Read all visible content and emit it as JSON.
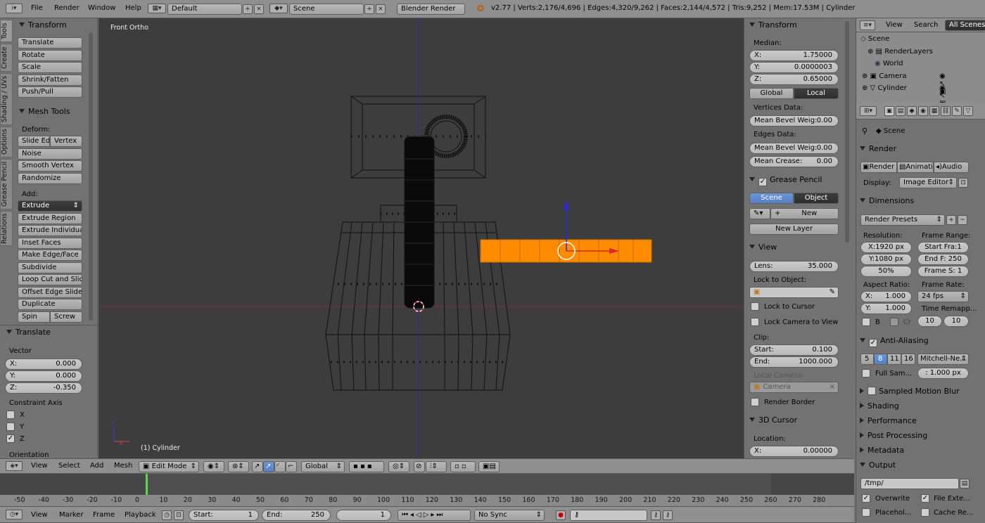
{
  "topbar": {
    "menus": [
      "File",
      "Render",
      "Window",
      "Help"
    ],
    "layout": "Default",
    "scene": "Scene",
    "engine": "Blender Render",
    "stats": "v2.77 | Verts:2,176/4,696 | Edges:4,320/9,262 | Faces:2,144/4,572 | Tris:9,252 | Mem:17.53M | Cylinder"
  },
  "vtabs": [
    "Tools",
    "Create",
    "Shading / UVs",
    "Options",
    "Grease Pencil",
    "Relations"
  ],
  "tools": {
    "transform_title": "Transform",
    "transform": [
      "Translate",
      "Rotate",
      "Scale",
      "Shrink/Fatten",
      "Push/Pull"
    ],
    "meshtools_title": "Mesh Tools",
    "deform_label": "Deform:",
    "slide_edge": "Slide Ed",
    "vertex": "Vertex",
    "deform": [
      "Noise",
      "Smooth Vertex",
      "Randomize"
    ],
    "add_label": "Add:",
    "extrude": "Extrude",
    "add": [
      "Extrude Region",
      "Extrude Individual",
      "Inset Faces",
      "Make Edge/Face",
      "Subdivide",
      "Loop Cut and Slide",
      "Offset Edge Slide",
      "Duplicate"
    ],
    "spin": "Spin",
    "screw": "Screw"
  },
  "operator": {
    "title": "Translate",
    "vector_label": "Vector",
    "x_label": "X:",
    "x": "0.000",
    "y_label": "Y:",
    "y": "0.000",
    "z_label": "Z:",
    "z": "-0.350",
    "constraint_label": "Constraint Axis",
    "axes": [
      "X",
      "Y",
      "Z"
    ],
    "orientation_label": "Orientation"
  },
  "viewport": {
    "view_name": "Front Ortho",
    "object_name": "(1) Cylinder"
  },
  "properties": {
    "transform_title": "Transform",
    "median_label": "Median:",
    "x_label": "X:",
    "x": "1.75000",
    "y_label": "Y:",
    "y": "0.0000003",
    "z_label": "Z:",
    "z": "0.65000",
    "global": "Global",
    "local": "Local",
    "vertices_data": "Vertices Data:",
    "mean_bevel_label": "Mean Bevel Weig:",
    "mean_bevel_v": "0.00",
    "edges_data": "Edges Data:",
    "mean_bevel_e": "0.00",
    "mean_crease_label": "Mean Crease:",
    "mean_crease": "0.00",
    "grease_title": "Grease Pencil",
    "gp_scene": "Scene",
    "gp_object": "Object",
    "gp_new": "New",
    "gp_new_layer": "New Layer",
    "view_title": "View",
    "lens_label": "Lens:",
    "lens": "35.000",
    "lock_object": "Lock to Object:",
    "lock_cursor": "Lock to Cursor",
    "lock_camera": "Lock Camera to View",
    "clip_label": "Clip:",
    "clip_start_label": "Start:",
    "clip_start": "0.100",
    "clip_end_label": "End:",
    "clip_end": "1000.000",
    "local_camera": "Local Camera:",
    "camera": "Camera",
    "render_border": "Render Border",
    "cursor_title": "3D Cursor",
    "location_label": "Location:",
    "cursor_x_label": "X:",
    "cursor_x": "0.00000"
  },
  "outliner": {
    "view": "View",
    "search": "Search",
    "scenes": "All Scenes",
    "items": [
      "Scene",
      "RenderLayers",
      "World",
      "Camera",
      "Cylinder"
    ]
  },
  "render": {
    "breadcrumb": "Scene",
    "render_title": "Render",
    "render_btn": "Render",
    "anim_btn": "Animati",
    "audio_btn": "Audio",
    "display_label": "Display:",
    "display": "Image Editor",
    "dimensions_title": "Dimensions",
    "presets": "Render Presets",
    "resolution_label": "Resolution:",
    "res_x": "X:1920 px",
    "res_y": "Y:1080 px",
    "res_pct": "50%",
    "frame_range_label": "Frame Range:",
    "start_frame": "Start Fra:1",
    "end_frame": "End F: 250",
    "frame_step": "Frame S: 1",
    "aspect_label": "Aspect Ratio:",
    "asp_x_label": "X:",
    "asp_x": "1.000",
    "asp_y_label": "Y:",
    "asp_y": "1.000",
    "frame_rate_label": "Frame Rate:",
    "fps": "24 fps",
    "time_remap_label": "Time Remapp...",
    "remap_old": "10",
    "remap_new": "10",
    "b_label": "B",
    "cr_label": "Cr",
    "aa_title": "Anti-Aliasing",
    "aa_samples": [
      "5",
      "8",
      "11",
      "16"
    ],
    "aa_filter": "Mitchell-Ne...",
    "full_sample": "Full Sam...",
    "filter_size": ": 1.000 px",
    "motion_blur": "Sampled Motion Blur",
    "shading": "Shading",
    "performance": "Performance",
    "post_processing": "Post Processing",
    "metadata": "Metadata",
    "output": "Output",
    "output_path": "/tmp/",
    "overwrite": "Overwrite",
    "file_ext": "File Exte...",
    "placeholders": "Placehol...",
    "cache_result": "Cache Re..."
  },
  "viewheader": {
    "menus": [
      "View",
      "Select",
      "Add",
      "Mesh"
    ],
    "mode": "Edit Mode",
    "orientation": "Global"
  },
  "timeline": {
    "ticks": [
      "-50",
      "-40",
      "-30",
      "-20",
      "-10",
      "0",
      "10",
      "20",
      "30",
      "40",
      "50",
      "60",
      "70",
      "80",
      "90",
      "100",
      "110",
      "120",
      "130",
      "140",
      "150",
      "160",
      "170",
      "180",
      "190",
      "200",
      "210",
      "220",
      "230",
      "240",
      "250",
      "260",
      "270",
      "280"
    ],
    "menus": [
      "View",
      "Marker",
      "Frame",
      "Playback"
    ],
    "start_label": "Start:",
    "start": "1",
    "end_label": "End:",
    "end": "250",
    "current": "1",
    "sync": "No Sync"
  },
  "colors": {
    "viewport_bg": "#3d3d3d",
    "selected": "#ff8c00",
    "panel": "#727272"
  }
}
